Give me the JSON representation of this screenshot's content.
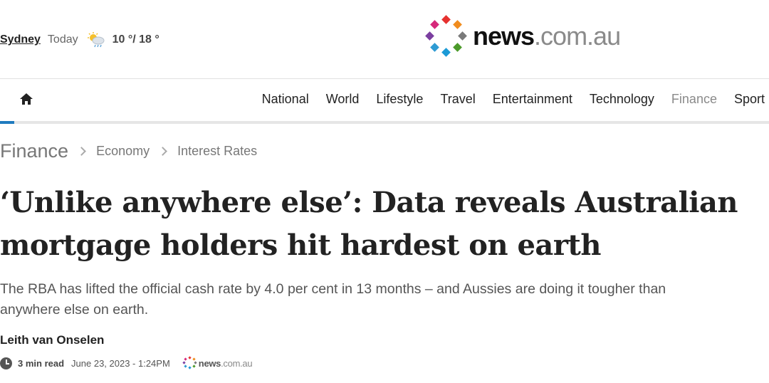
{
  "weather": {
    "city": "Sydney",
    "day": "Today",
    "icon": "partly-cloudy-rain-icon",
    "temps": "10 °/ 18 °"
  },
  "brand": {
    "name": "news",
    "tld": ".com.au",
    "colors": [
      "#e6312f",
      "#f08c1e",
      "#7a7a7a",
      "#4c9a2a",
      "#1c9ad6",
      "#2e9bd3",
      "#7b3fa0",
      "#d6287a"
    ]
  },
  "nav": {
    "home_icon": "home-icon",
    "items": [
      {
        "label": "National",
        "active": false
      },
      {
        "label": "World",
        "active": false
      },
      {
        "label": "Lifestyle",
        "active": false
      },
      {
        "label": "Travel",
        "active": false
      },
      {
        "label": "Entertainment",
        "active": false
      },
      {
        "label": "Technology",
        "active": false
      },
      {
        "label": "Finance",
        "active": true
      },
      {
        "label": "Sport",
        "active": false
      }
    ],
    "accent_color": "#1f7bbf"
  },
  "breadcrumb": {
    "root": "Finance",
    "items": [
      "Economy",
      "Interest Rates"
    ]
  },
  "article": {
    "headline_line1": "‘Unlike anywhere else’: Data reveals Australian",
    "headline_line2": "mortgage holders hit hardest on earth",
    "standfirst_line1": "The RBA has lifted the official cash rate by 4.0 per cent in 13 months – and Aussies are doing it tougher than",
    "standfirst_line2": "anywhere else on earth.",
    "author": "Leith van Onselen",
    "read_time": "3 min read",
    "date": "June 23, 2023 - 1:24PM",
    "source_name": "news",
    "source_tld": ".com.au"
  }
}
